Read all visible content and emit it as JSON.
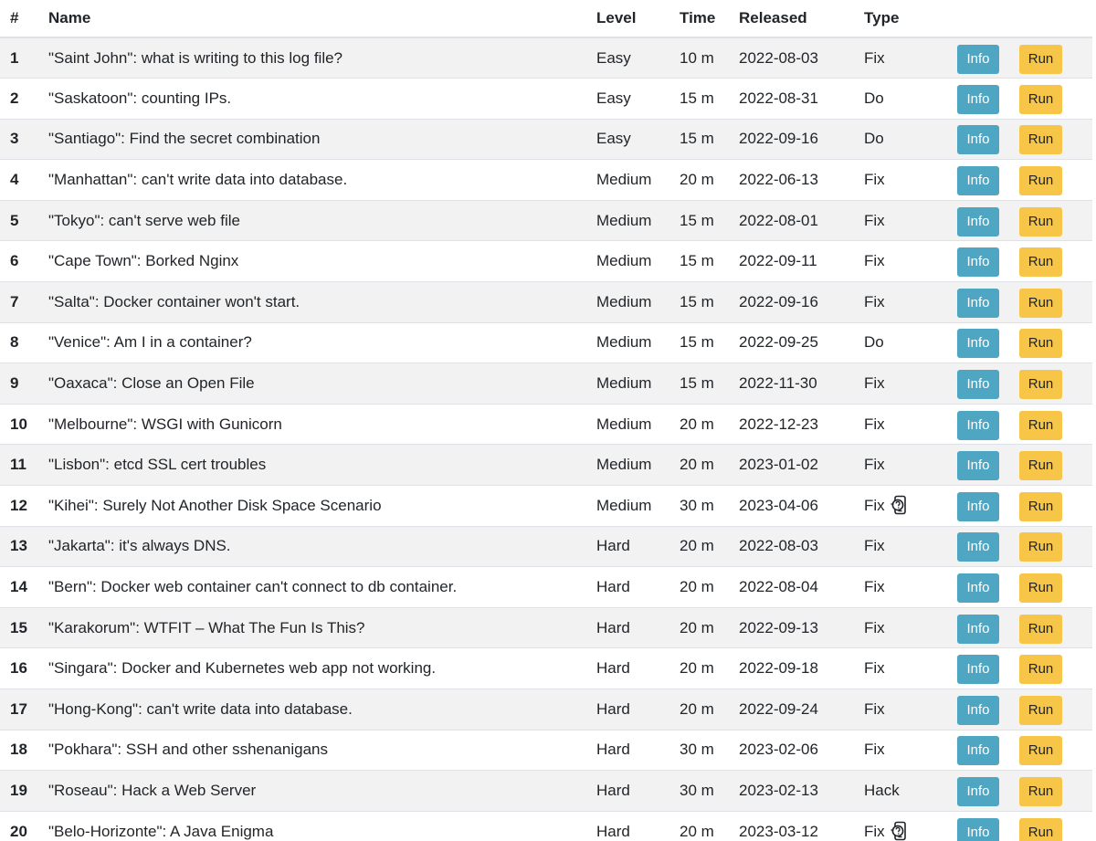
{
  "headers": {
    "num": "#",
    "name": "Name",
    "level": "Level",
    "time": "Time",
    "released": "Released",
    "type": "Type"
  },
  "buttons": {
    "info": "Info",
    "run": "Run"
  },
  "icons": {
    "hint": "phone-help-icon"
  },
  "colors": {
    "info_button": "#4fa6c2",
    "run_button": "#f7c548",
    "row_stripe": "#f2f2f2"
  },
  "rows": [
    {
      "num": "1",
      "name": "\"Saint John\": what is writing to this log file?",
      "level": "Easy",
      "time": "10 m",
      "released": "2022-08-03",
      "type": "Fix",
      "hint": false
    },
    {
      "num": "2",
      "name": "\"Saskatoon\": counting IPs.",
      "level": "Easy",
      "time": "15 m",
      "released": "2022-08-31",
      "type": "Do",
      "hint": false
    },
    {
      "num": "3",
      "name": "\"Santiago\": Find the secret combination",
      "level": "Easy",
      "time": "15 m",
      "released": "2022-09-16",
      "type": "Do",
      "hint": false
    },
    {
      "num": "4",
      "name": "\"Manhattan\": can't write data into database.",
      "level": "Medium",
      "time": "20 m",
      "released": "2022-06-13",
      "type": "Fix",
      "hint": false
    },
    {
      "num": "5",
      "name": "\"Tokyo\": can't serve web file",
      "level": "Medium",
      "time": "15 m",
      "released": "2022-08-01",
      "type": "Fix",
      "hint": false
    },
    {
      "num": "6",
      "name": "\"Cape Town\": Borked Nginx",
      "level": "Medium",
      "time": "15 m",
      "released": "2022-09-11",
      "type": "Fix",
      "hint": false
    },
    {
      "num": "7",
      "name": "\"Salta\": Docker container won't start.",
      "level": "Medium",
      "time": "15 m",
      "released": "2022-09-16",
      "type": "Fix",
      "hint": false
    },
    {
      "num": "8",
      "name": "\"Venice\": Am I in a container?",
      "level": "Medium",
      "time": "15 m",
      "released": "2022-09-25",
      "type": "Do",
      "hint": false
    },
    {
      "num": "9",
      "name": "\"Oaxaca\": Close an Open File",
      "level": "Medium",
      "time": "15 m",
      "released": "2022-11-30",
      "type": "Fix",
      "hint": false
    },
    {
      "num": "10",
      "name": "\"Melbourne\": WSGI with Gunicorn",
      "level": "Medium",
      "time": "20 m",
      "released": "2022-12-23",
      "type": "Fix",
      "hint": false
    },
    {
      "num": "11",
      "name": "\"Lisbon\": etcd SSL cert troubles",
      "level": "Medium",
      "time": "20 m",
      "released": "2023-01-02",
      "type": "Fix",
      "hint": false
    },
    {
      "num": "12",
      "name": "\"Kihei\": Surely Not Another Disk Space Scenario",
      "level": "Medium",
      "time": "30 m",
      "released": "2023-04-06",
      "type": "Fix",
      "hint": true
    },
    {
      "num": "13",
      "name": "\"Jakarta\": it's always DNS.",
      "level": "Hard",
      "time": "20 m",
      "released": "2022-08-03",
      "type": "Fix",
      "hint": false
    },
    {
      "num": "14",
      "name": "\"Bern\": Docker web container can't connect to db container.",
      "level": "Hard",
      "time": "20 m",
      "released": "2022-08-04",
      "type": "Fix",
      "hint": false
    },
    {
      "num": "15",
      "name": "\"Karakorum\": WTFIT – What The Fun Is This?",
      "level": "Hard",
      "time": "20 m",
      "released": "2022-09-13",
      "type": "Fix",
      "hint": false
    },
    {
      "num": "16",
      "name": "\"Singara\": Docker and Kubernetes web app not working.",
      "level": "Hard",
      "time": "20 m",
      "released": "2022-09-18",
      "type": "Fix",
      "hint": false
    },
    {
      "num": "17",
      "name": "\"Hong-Kong\": can't write data into database.",
      "level": "Hard",
      "time": "20 m",
      "released": "2022-09-24",
      "type": "Fix",
      "hint": false
    },
    {
      "num": "18",
      "name": "\"Pokhara\": SSH and other sshenanigans",
      "level": "Hard",
      "time": "30 m",
      "released": "2023-02-06",
      "type": "Fix",
      "hint": false
    },
    {
      "num": "19",
      "name": "\"Roseau\": Hack a Web Server",
      "level": "Hard",
      "time": "30 m",
      "released": "2023-02-13",
      "type": "Hack",
      "hint": false
    },
    {
      "num": "20",
      "name": "\"Belo-Horizonte\": A Java Enigma",
      "level": "Hard",
      "time": "20 m",
      "released": "2023-03-12",
      "type": "Fix",
      "hint": true
    }
  ]
}
